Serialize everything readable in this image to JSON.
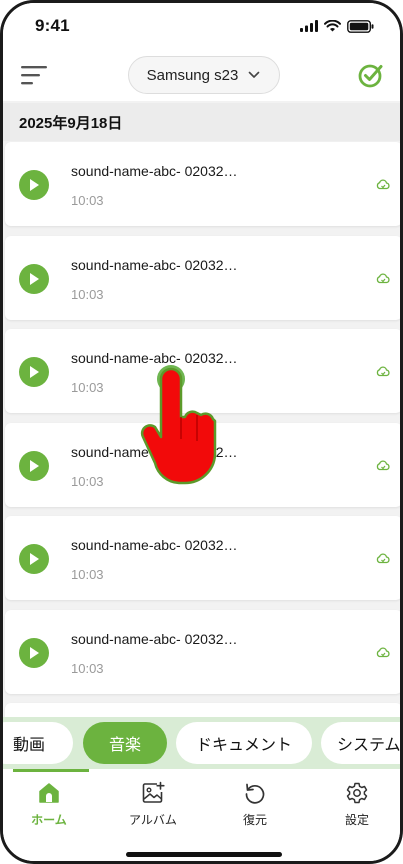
{
  "status_bar": {
    "time": "9:41"
  },
  "header": {
    "menu_icon": "hamburger-icon",
    "device_name": "Samsung s23",
    "select_all_icon": "check-circle-icon",
    "accent": "#6cb33f"
  },
  "date_header": "2025年9月18日",
  "sounds": [
    {
      "name": "sound-name-abc- 02032…",
      "time": "10:03"
    },
    {
      "name": "sound-name-abc- 02032…",
      "time": "10:03"
    },
    {
      "name": "sound-name-abc- 02032…",
      "time": "10:03"
    },
    {
      "name": "sound-name-abc- 02032…",
      "time": "10:03"
    },
    {
      "name": "sound-name-abc- 02032…",
      "time": "10:03"
    },
    {
      "name": "sound-name-abc- 02032…",
      "time": "10:03"
    }
  ],
  "categories": [
    {
      "label": "動画",
      "active": false
    },
    {
      "label": "音楽",
      "active": true
    },
    {
      "label": "ドキュメント",
      "active": false
    },
    {
      "label": "システム",
      "active": false
    }
  ],
  "bottom_nav": [
    {
      "label": "ホーム",
      "icon": "home-icon",
      "active": true
    },
    {
      "label": "アルバム",
      "icon": "album-add-icon",
      "active": false
    },
    {
      "label": "復元",
      "icon": "restore-icon",
      "active": false
    },
    {
      "label": "設定",
      "icon": "settings-gear-icon",
      "active": false
    }
  ]
}
